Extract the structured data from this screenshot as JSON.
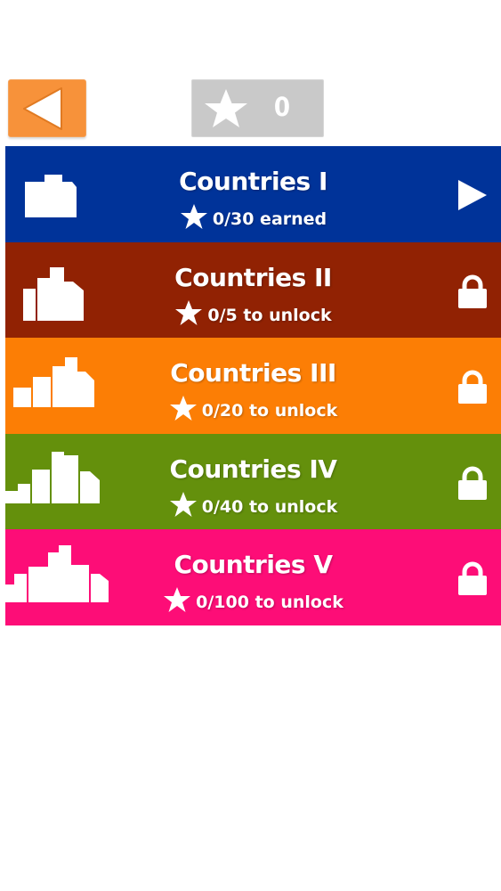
{
  "header": {
    "back_icon": "back-arrow-icon",
    "star_icon": "star-icon",
    "star_count": "0",
    "back_color": "#f7923a",
    "star_box_color": "#c9c9c9"
  },
  "levels": [
    {
      "title": "Countries I",
      "subtitle": "0/30 earned",
      "color": "#003399",
      "status": "play",
      "icon": "play-icon"
    },
    {
      "title": "Countries II",
      "subtitle": "0/5 to unlock",
      "color": "#912203",
      "status": "locked",
      "icon": "lock-icon"
    },
    {
      "title": "Countries III",
      "subtitle": "0/20 to unlock",
      "color": "#fc7e05",
      "status": "locked",
      "icon": "lock-icon"
    },
    {
      "title": "Countries IV",
      "subtitle": "0/40 to unlock",
      "color": "#64900c",
      "status": "locked",
      "icon": "lock-icon"
    },
    {
      "title": "Countries V",
      "subtitle": "0/100 to unlock",
      "color": "#fd0d77",
      "status": "locked",
      "icon": "lock-icon"
    }
  ]
}
